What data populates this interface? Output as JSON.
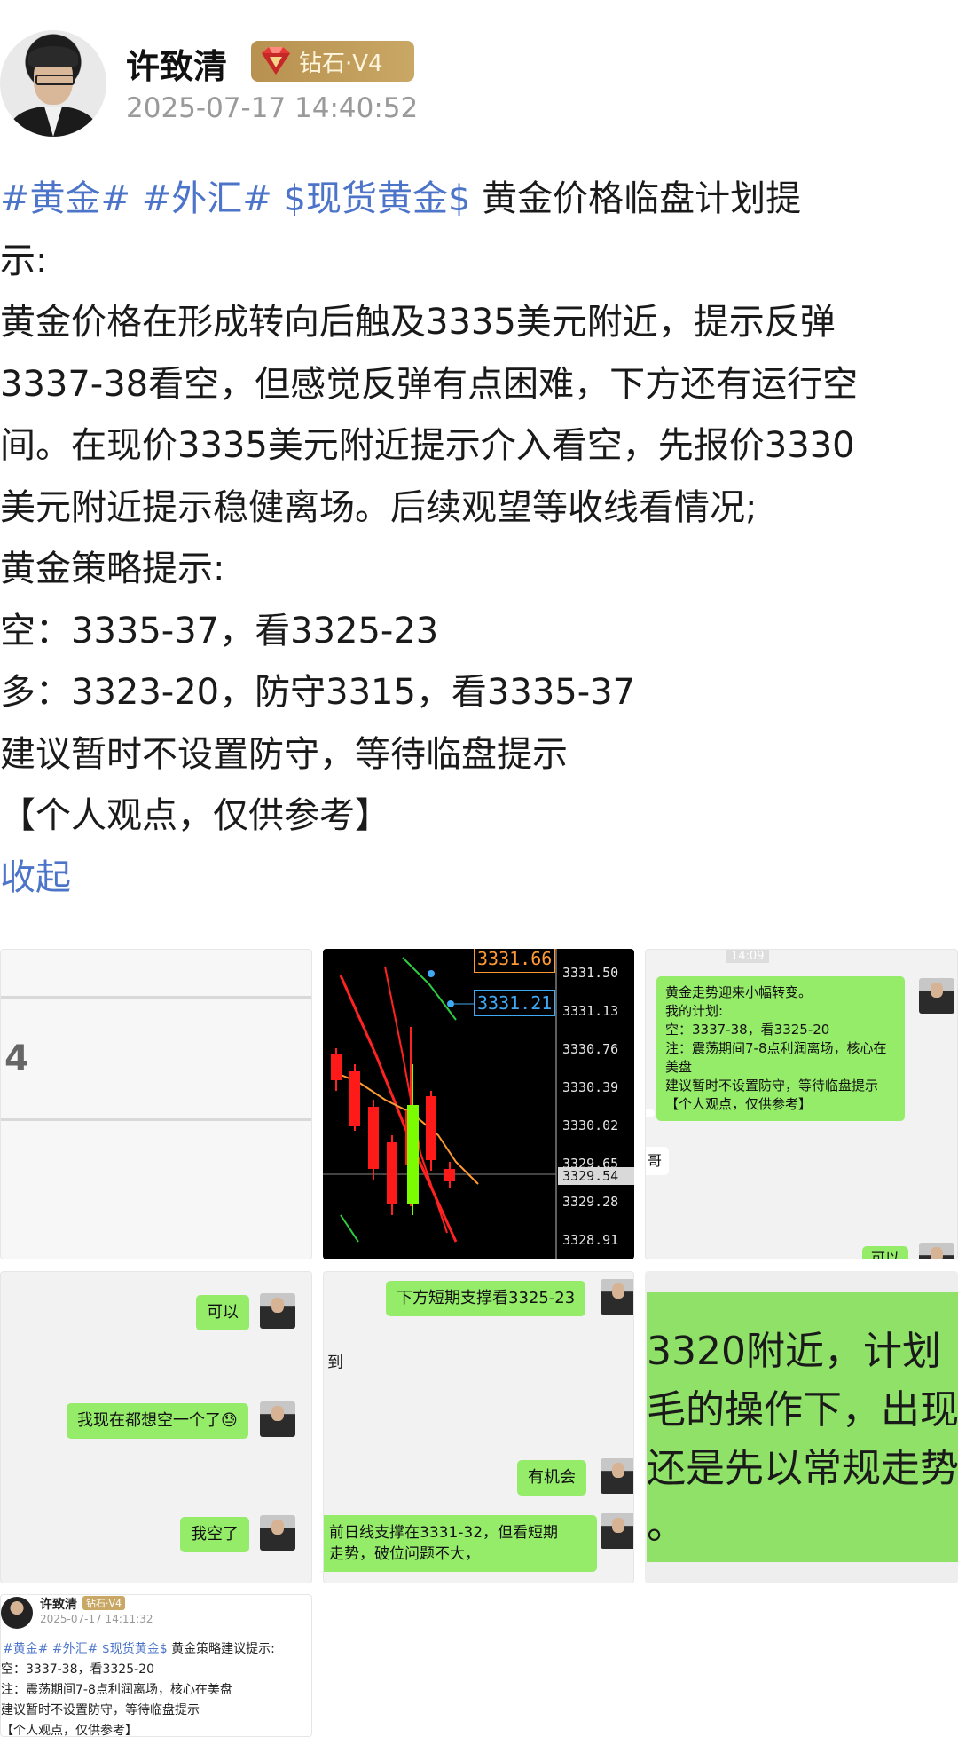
{
  "header": {
    "user_name": "许致清",
    "badge_text": "钻石·V4",
    "timestamp": "2025-07-17 14:40:52"
  },
  "post": {
    "topics": [
      "#黄金#",
      "#外汇#",
      "$现货黄金$"
    ],
    "line1_text": " 黄金价格临盘计划提",
    "line2": "示:",
    "line3": "黄金价格在形成转向后触及3335美元附近，提示反弹",
    "line4": "3337-38看空，但感觉反弹有点困难，下方还有运行空",
    "line5": "间。在现价3335美元附近提示介入看空，先报价3330",
    "line6": "美元附近提示稳健离场。后续观望等收线看情况;",
    "line7": "黄金策略提示:",
    "line8": "空：3335-37，看3325-23",
    "line9": "多：3323-20，防守3315，看3335-37",
    "line10": "建议暂时不设置防守，等待临盘提示",
    "line11": "【个人观点，仅供参考】",
    "collapse_label": "收起"
  },
  "images": {
    "img1": {
      "label": "4"
    },
    "img2": {
      "price_high": "3331.66",
      "price_mark": "3331.21",
      "price_current": "3329.54",
      "axis_ticks": [
        "3331.50",
        "3331.13",
        "3330.76",
        "3330.39",
        "3330.02",
        "3329.65",
        "3329.28",
        "3328.91"
      ]
    },
    "img3": {
      "time": "14:09",
      "msg_lines": [
        "黄金走势迎来小幅转变。",
        "我的计划:",
        "空：3337-38，看3325-20",
        "注：震荡期间7-8点利润离场，核心在",
        "美盘",
        "建议暂时不设置防守，等待临盘提示",
        "【个人观点，仅供参考】"
      ],
      "side_text": "哥",
      "bottom_reply": "可以"
    },
    "img4": {
      "msg1": "可以",
      "msg2": "我现在都想空一个了😓",
      "msg3": "我空了"
    },
    "img5": {
      "msg1": "下方短期支撑看3325-23",
      "left_text": "到",
      "msg2": "有机会",
      "msg3_line1": "前日线支撑在3331-32，但看短期",
      "msg3_line2": "走势，破位问题不大，"
    },
    "img6": {
      "line1": "3320附近，计划",
      "line2": "毛的操作下，出现",
      "line3": "还是先以常规走势",
      "bottom": "。"
    },
    "img7": {
      "name": "许致清",
      "badge": "钻石·V4",
      "time": "2025-07-17 14:11:32",
      "topics": "#黄金# #外汇# $现货黄金$",
      "title_text": " 黄金策略建议提示:",
      "line2": "空：3337-38，看3325-20",
      "line3": "注：震荡期间7-8点利润离场，核心在美盘",
      "line4": "建议暂时不设置防守，等待临盘提示",
      "line5": "【个人观点，仅供参考】"
    }
  },
  "colors": {
    "topic_blue": "#4c74c9",
    "chat_green": "#95ec69",
    "badge_gold": "#b7914f",
    "candle_red": "#ff1a1a",
    "candle_green": "#7cfc00"
  }
}
